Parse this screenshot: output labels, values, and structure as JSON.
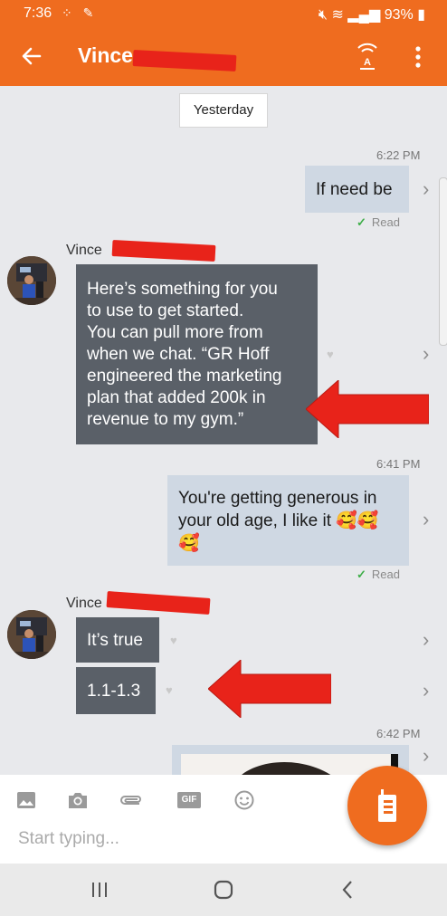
{
  "status_bar": {
    "time": "7:36",
    "battery": "93%"
  },
  "app_bar": {
    "contact_name": "Vince"
  },
  "date_separator": "Yesterday",
  "messages": [
    {
      "time": "6:22 PM",
      "text": "If need be",
      "status": "Read"
    },
    {
      "sender": "Vince",
      "lines": [
        "Here’s something for you",
        "to use to get started.",
        "You can pull more from",
        "when we chat. “GR Hoff",
        "engineered the marketing",
        "plan that added 200k in",
        "revenue to my gym.”"
      ]
    },
    {
      "time": "6:41 PM",
      "lines": [
        "You're getting generous in",
        "your old age, I like it 🥰🥰",
        "🥰"
      ],
      "status": "Read"
    },
    {
      "sender": "Vince",
      "text1": "It’s true",
      "text2": "1.1-1.3"
    },
    {
      "time": "6:42 PM"
    }
  ],
  "composer": {
    "placeholder": "Start typing..."
  },
  "icons": {
    "back": "back-arrow-icon",
    "wifi_calling": "wifi-a-icon",
    "more": "more-vert-icon",
    "gallery": "image-icon",
    "camera": "camera-icon",
    "attach": "paperclip-icon",
    "gif": "gif-icon",
    "emoji": "emoji-icon",
    "send": "walkie-talkie-icon"
  },
  "colors": {
    "accent": "#ef6c1f",
    "incoming_bubble": "#5a6068",
    "outgoing_bubble": "#cfd8e3",
    "annotation_red": "#e8231a",
    "read_check": "#3fae49"
  }
}
